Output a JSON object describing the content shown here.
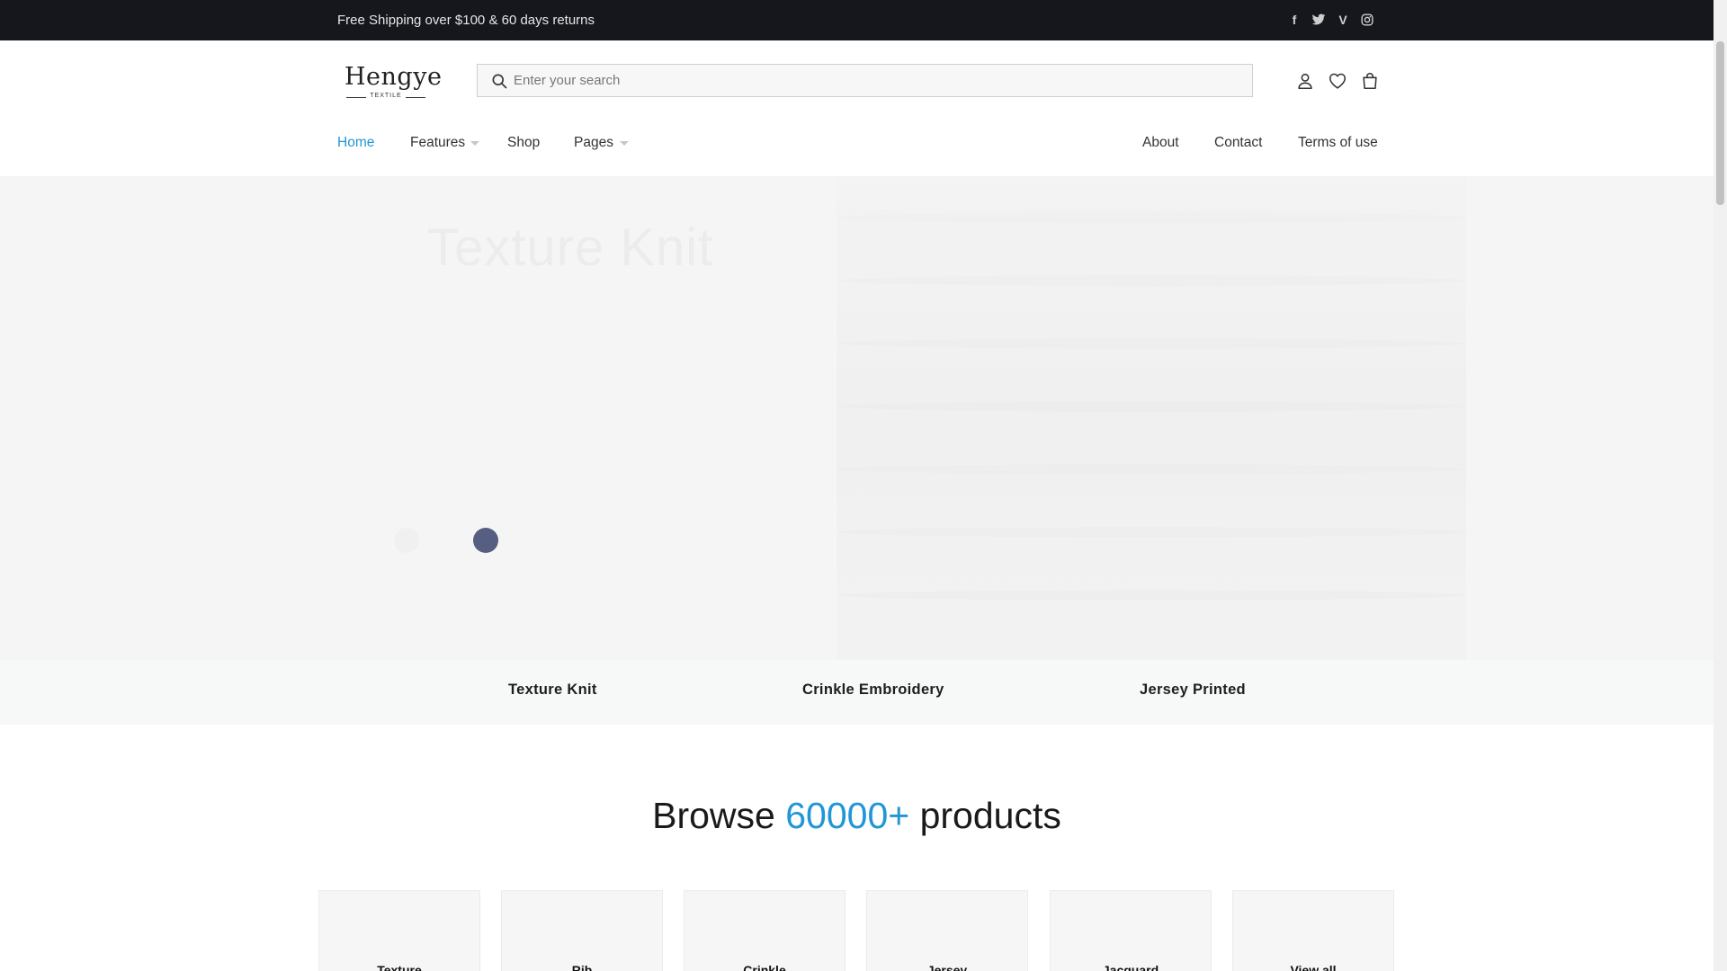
{
  "topbar": {
    "promo": "Free Shipping over $100 & 60 days returns",
    "social_icons": [
      "facebook-icon",
      "twitter-icon",
      "vimeo-icon",
      "instagram-icon"
    ],
    "social_glyphs": [
      "f",
      "t",
      "V",
      "◎"
    ]
  },
  "logo": {
    "name": "Hengye",
    "sub": "TEXTILE"
  },
  "search": {
    "placeholder": "Enter your search",
    "value": ""
  },
  "header_icons": [
    "user-icon",
    "heart-icon",
    "bag-icon"
  ],
  "nav": {
    "left": [
      {
        "label": "Home",
        "active": true,
        "has_dropdown": false
      },
      {
        "label": "Features",
        "active": false,
        "has_dropdown": true
      },
      {
        "label": "Shop",
        "active": false,
        "has_dropdown": false
      },
      {
        "label": "Pages",
        "active": false,
        "has_dropdown": true
      }
    ],
    "right": [
      {
        "label": "About"
      },
      {
        "label": "Contact"
      },
      {
        "label": "Terms of use"
      }
    ]
  },
  "hero": {
    "title": "Texture Knit",
    "slides": 2,
    "active_slide": 2
  },
  "tabs": [
    "Texture Knit",
    "Crinkle Embroidery",
    "Jersey Printed"
  ],
  "browse": {
    "prefix": "Browse ",
    "count": "60000+",
    "suffix": " products"
  },
  "categories": [
    "Texture",
    "Rib",
    "Crinkle",
    "Jersey",
    "Jacquard",
    "View all"
  ],
  "colors": {
    "accent": "#2196d6",
    "topbar_bg": "#16161d",
    "active_dot": "#565e82"
  }
}
